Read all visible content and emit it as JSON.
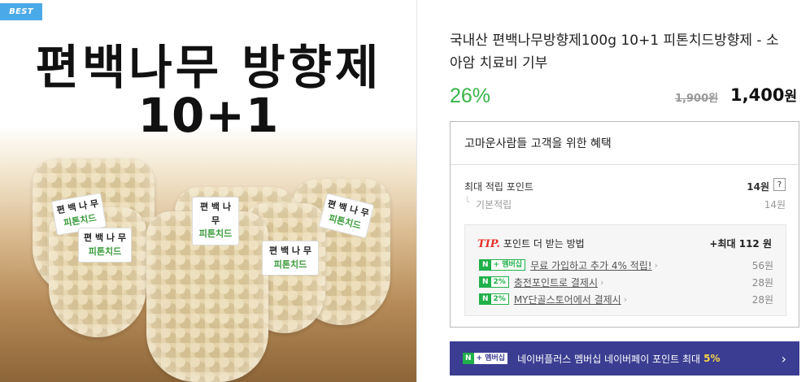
{
  "badge": "BEST",
  "hero": {
    "line1": "편백나무 방향제",
    "line2": "10+1"
  },
  "bag_labels": [
    {
      "top": "편 백 나 무",
      "mid": "피톤치드"
    },
    {
      "top": "편 백 나 무",
      "mid": "피톤치드"
    },
    {
      "top": "편 백 나 무",
      "mid": "피톤치드"
    },
    {
      "top": "편 백 나 무",
      "mid": "피톤치드"
    },
    {
      "top": "편 백 나 무",
      "mid": "피톤치드"
    }
  ],
  "product": {
    "title": "국내산 편백나무방향제100g 10+1 피톤치드방향제 - 소아암 치료비 기부",
    "discount": "26%",
    "original_price": "1,900원",
    "sale_price": "1,400",
    "sale_unit": "원"
  },
  "benefits": {
    "heading": "고마운사람들 고객을 위한 혜택",
    "max_point_label": "최대 적립 포인트",
    "max_point_value": "14원",
    "help_icon": "?",
    "basic_label": "기본적립",
    "basic_value": "14원",
    "tip": {
      "tag": "TIP.",
      "label": "포인트 더 받는 방법",
      "max": "+최대 112 원",
      "rows": [
        {
          "badge_n": "N",
          "badge_t": "+ 멤버십",
          "text": "무료 가입하고 추가 4% 적립!",
          "amount": "56원"
        },
        {
          "badge_n": "N",
          "badge_t": "2%",
          "text": "충전포인트로 결제시",
          "amount": "28원"
        },
        {
          "badge_n": "N",
          "badge_t": "2%",
          "text": "MY단골스토어에서 결제시",
          "amount": "28원"
        }
      ]
    }
  },
  "npay": {
    "badge_n": "N",
    "badge_t": "+ 멤버십",
    "text": "네이버플러스 멤버십 네이버페이 포인트 최대",
    "percent": "5%",
    "arrow": "›"
  },
  "colors": {
    "discount": "#38b54a",
    "tip_tag": "#e8312b",
    "npay_bar": "#3a3d91",
    "naver_green": "#20b04a",
    "best_badge": "#4aa9e8"
  },
  "icons": [
    "help-icon",
    "chevron-right-icon",
    "naver-n-icon"
  ]
}
